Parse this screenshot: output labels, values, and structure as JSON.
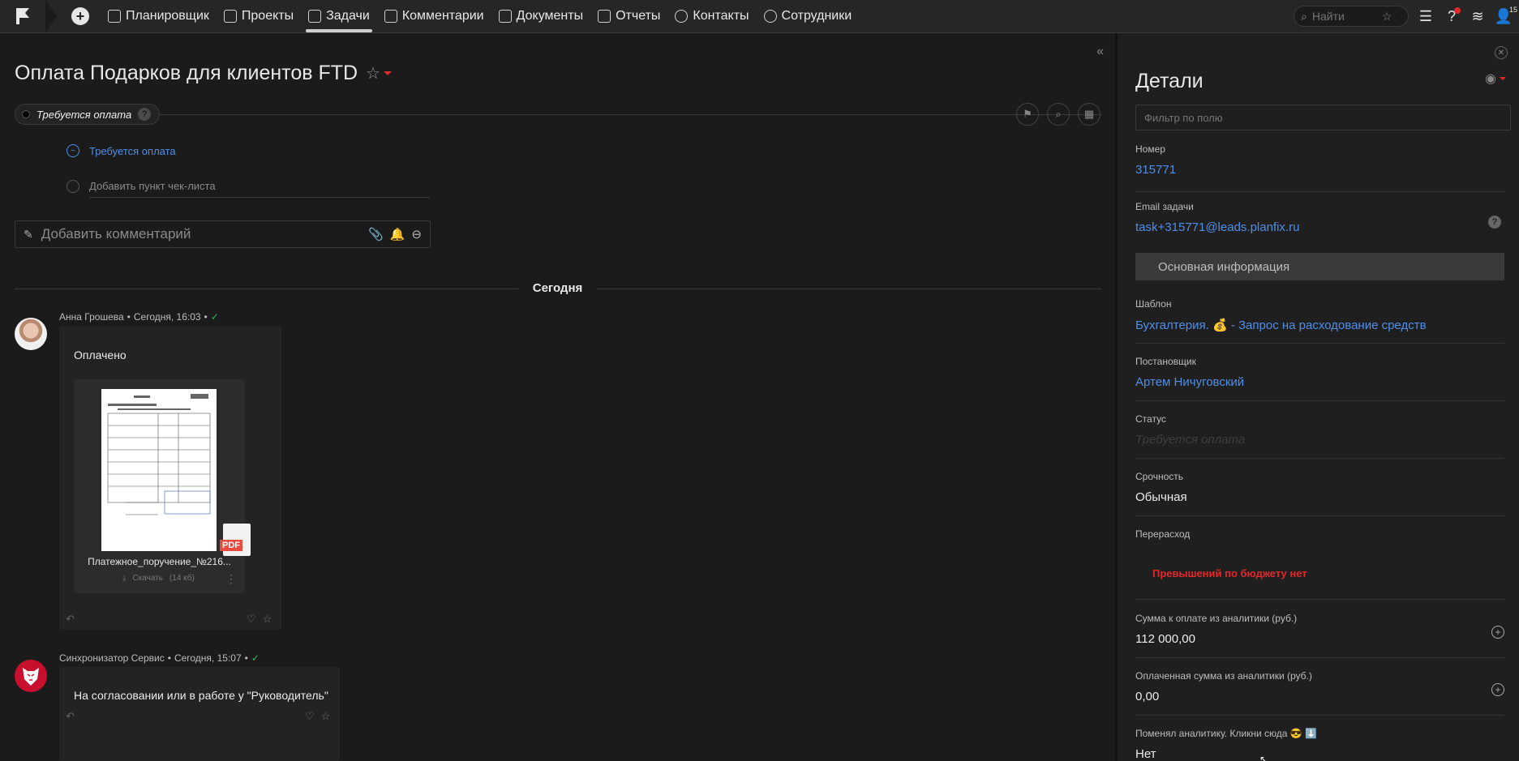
{
  "nav": {
    "items": [
      {
        "label": "Планировщик",
        "icon": "planner-icon"
      },
      {
        "label": "Проекты",
        "icon": "projects-icon"
      },
      {
        "label": "Задачи",
        "icon": "tasks-icon"
      },
      {
        "label": "Комментарии",
        "icon": "comments-icon"
      },
      {
        "label": "Документы",
        "icon": "documents-icon"
      },
      {
        "label": "Отчеты",
        "icon": "reports-icon"
      },
      {
        "label": "Контакты",
        "icon": "contacts-icon"
      },
      {
        "label": "Сотрудники",
        "icon": "employees-icon"
      }
    ],
    "active": "Задачи",
    "search_placeholder": "Найти",
    "user_badge": "15"
  },
  "task": {
    "title": "Оплата Подарков для клиентов FTD",
    "status": "Требуется оплата",
    "checklist": {
      "item": "Требуется оплата",
      "add_placeholder": "Добавить пункт чек-листа"
    },
    "comment_placeholder": "Добавить комментарий"
  },
  "feed": {
    "day_label": "Сегодня",
    "messages": [
      {
        "author": "Анна Грошева",
        "time": "Сегодня, 16:03",
        "text": "Оплачено",
        "file": {
          "name": "Платежное_поручение_№216...",
          "download": "Скачать",
          "size": "(14 кб)",
          "type": "PDF"
        }
      },
      {
        "author": "Синхронизатор Сервис",
        "time": "Сегодня, 15:07",
        "text": "На согласовании или в работе у \"Руководитель\""
      }
    ]
  },
  "details": {
    "title": "Детали",
    "filter_placeholder": "Фильтр по полю",
    "number_label": "Номер",
    "number": "315771",
    "email_label": "Email задачи",
    "email": "task+315771@leads.planfix.ru",
    "section": "Основная информация",
    "template_label": "Шаблон",
    "template": "Бухгалтерия. 💰 - Запрос на расходование средств",
    "assigner_label": "Постановщик",
    "assigner": "Артем Ничуговский",
    "status_label": "Статус",
    "status": "Требуется оплата",
    "urgency_label": "Срочность",
    "urgency": "Обычная",
    "overrun_label": "Перерасход",
    "overrun": "Превышений по бюджету нет",
    "to_pay_label": "Сумма к оплате из аналитики (руб.)",
    "to_pay": "112 000,00",
    "paid_label": "Оплаченная сумма из аналитики (руб.)",
    "paid": "0,00",
    "changed_label": "Поменял аналитику. Кликни сюда 😎 ⬇️",
    "changed": "Нет"
  },
  "colors": {
    "accent_link": "#4f8ee6",
    "alert": "#e0292b",
    "success": "#3bb36a"
  }
}
